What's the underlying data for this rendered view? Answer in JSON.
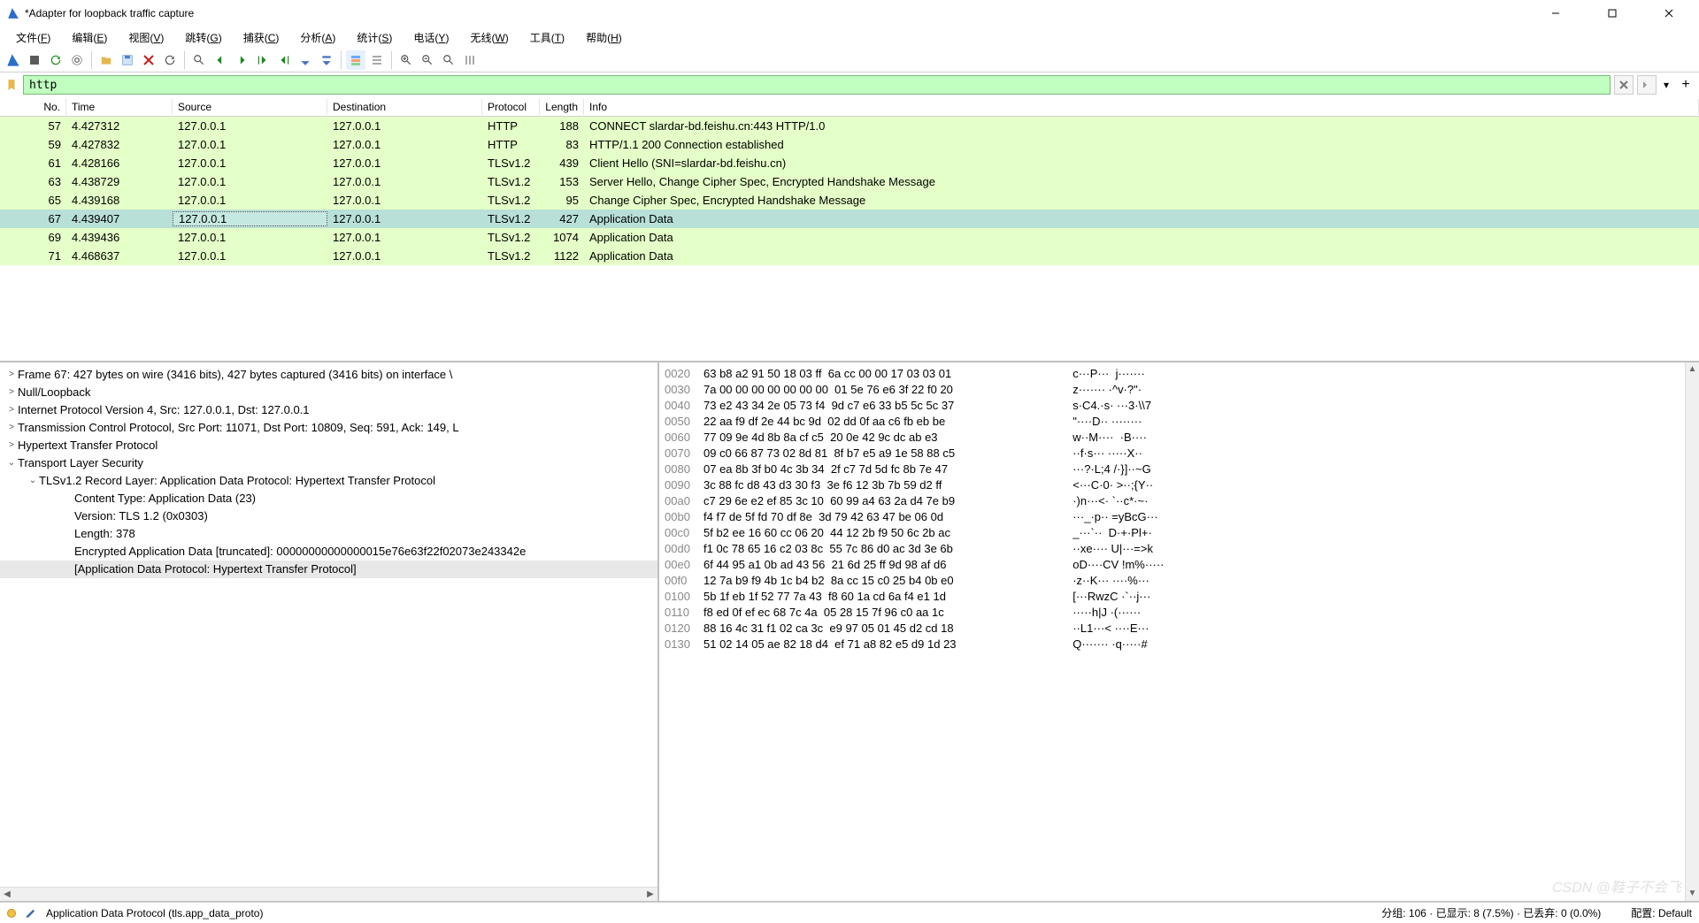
{
  "title": "*Adapter for loopback traffic capture",
  "menus": [
    "文件(F)",
    "编辑(E)",
    "视图(V)",
    "跳转(G)",
    "捕获(C)",
    "分析(A)",
    "统计(S)",
    "电话(Y)",
    "无线(W)",
    "工具(T)",
    "帮助(H)"
  ],
  "filter": {
    "value": "http"
  },
  "columns": [
    "No.",
    "Time",
    "Source",
    "Destination",
    "Protocol",
    "Length",
    "Info"
  ],
  "packets": [
    {
      "no": "57",
      "time": "4.427312",
      "src": "127.0.0.1",
      "dst": "127.0.0.1",
      "proto": "HTTP",
      "len": "188",
      "info": "CONNECT slardar-bd.feishu.cn:443 HTTP/1.0",
      "sel": false
    },
    {
      "no": "59",
      "time": "4.427832",
      "src": "127.0.0.1",
      "dst": "127.0.0.1",
      "proto": "HTTP",
      "len": "83",
      "info": "HTTP/1.1 200 Connection established",
      "sel": false
    },
    {
      "no": "61",
      "time": "4.428166",
      "src": "127.0.0.1",
      "dst": "127.0.0.1",
      "proto": "TLSv1.2",
      "len": "439",
      "info": "Client Hello (SNI=slardar-bd.feishu.cn)",
      "sel": false
    },
    {
      "no": "63",
      "time": "4.438729",
      "src": "127.0.0.1",
      "dst": "127.0.0.1",
      "proto": "TLSv1.2",
      "len": "153",
      "info": "Server Hello, Change Cipher Spec, Encrypted Handshake Message",
      "sel": false
    },
    {
      "no": "65",
      "time": "4.439168",
      "src": "127.0.0.1",
      "dst": "127.0.0.1",
      "proto": "TLSv1.2",
      "len": "95",
      "info": "Change Cipher Spec, Encrypted Handshake Message",
      "sel": false
    },
    {
      "no": "67",
      "time": "4.439407",
      "src": "127.0.0.1",
      "dst": "127.0.0.1",
      "proto": "TLSv1.2",
      "len": "427",
      "info": "Application Data",
      "sel": true
    },
    {
      "no": "69",
      "time": "4.439436",
      "src": "127.0.0.1",
      "dst": "127.0.0.1",
      "proto": "TLSv1.2",
      "len": "1074",
      "info": "Application Data",
      "sel": false
    },
    {
      "no": "71",
      "time": "4.468637",
      "src": "127.0.0.1",
      "dst": "127.0.0.1",
      "proto": "TLSv1.2",
      "len": "1122",
      "info": "Application Data",
      "sel": false
    }
  ],
  "tree": [
    {
      "tw": ">",
      "ind": 0,
      "text": "Frame 67: 427 bytes on wire (3416 bits), 427 bytes captured (3416 bits) on interface \\",
      "sel": false
    },
    {
      "tw": ">",
      "ind": 0,
      "text": "Null/Loopback",
      "sel": false
    },
    {
      "tw": ">",
      "ind": 0,
      "text": "Internet Protocol Version 4, Src: 127.0.0.1, Dst: 127.0.0.1",
      "sel": false
    },
    {
      "tw": ">",
      "ind": 0,
      "text": "Transmission Control Protocol, Src Port: 11071, Dst Port: 10809, Seq: 591, Ack: 149, L",
      "sel": false
    },
    {
      "tw": ">",
      "ind": 0,
      "text": "Hypertext Transfer Protocol",
      "sel": false
    },
    {
      "tw": "v",
      "ind": 0,
      "text": "Transport Layer Security",
      "sel": false
    },
    {
      "tw": "v",
      "ind": 1,
      "text": "TLSv1.2 Record Layer: Application Data Protocol: Hypertext Transfer Protocol",
      "sel": false
    },
    {
      "tw": "",
      "ind": 2,
      "text": "Content Type: Application Data (23)",
      "sel": false
    },
    {
      "tw": "",
      "ind": 2,
      "text": "Version: TLS 1.2 (0x0303)",
      "sel": false
    },
    {
      "tw": "",
      "ind": 2,
      "text": "Length: 378",
      "sel": false
    },
    {
      "tw": "",
      "ind": 2,
      "text": "Encrypted Application Data [truncated]: 00000000000000015e76e63f22f02073e243342e",
      "sel": false
    },
    {
      "tw": "",
      "ind": 2,
      "text": "[Application Data Protocol: Hypertext Transfer Protocol]",
      "sel": true
    }
  ],
  "hex": [
    {
      "off": "0020",
      "b": "63 b8 a2 91 50 18 03 ff  6a cc 00 00 17 03 03 01",
      "a": "c···P···  j·······"
    },
    {
      "off": "0030",
      "b": "7a 00 00 00 00 00 00 00  01 5e 76 e6 3f 22 f0 20",
      "a": "z······· ·^v·?\"· "
    },
    {
      "off": "0040",
      "b": "73 e2 43 34 2e 05 73 f4  9d c7 e6 33 b5 5c 5c 37",
      "a": "s·C4.·s· ···3·\\\\7"
    },
    {
      "off": "0050",
      "b": "22 aa f9 df 2e 44 bc 9d  02 dd 0f aa c6 fb eb be",
      "a": "\"····D·· ········"
    },
    {
      "off": "0060",
      "b": "77 09 9e 4d 8b 8a cf c5  20 0e 42 9c dc ab e3",
      "a": "w··M····  ·B····"
    },
    {
      "off": "0070",
      "b": "09 c0 66 87 73 02 8d 81  8f b7 e5 a9 1e 58 88 c5",
      "a": "··f·s··· ·····X··"
    },
    {
      "off": "0080",
      "b": "07 ea 8b 3f b0 4c 3b 34  2f c7 7d 5d fc 8b 7e 47",
      "a": "···?·L;4 /·}]··~G"
    },
    {
      "off": "0090",
      "b": "3c 88 fc d8 43 d3 30 f3  3e f6 12 3b 7b 59 d2 ff",
      "a": "<···C·0· >··;{Y··"
    },
    {
      "off": "00a0",
      "b": "c7 29 6e e2 ef 85 3c 10  60 99 a4 63 2a d4 7e b9",
      "a": "·)n···<· `··c*·~·"
    },
    {
      "off": "00b0",
      "b": "f4 f7 de 5f fd 70 df 8e  3d 79 42 63 47 be 06 0d",
      "a": "···_·p·· =yBcG···"
    },
    {
      "off": "00c0",
      "b": "5f b2 ee 16 60 cc 06 20  44 12 2b f9 50 6c 2b ac",
      "a": "_···`··  D·+·Pl+·"
    },
    {
      "off": "00d0",
      "b": "f1 0c 78 65 16 c2 03 8c  55 7c 86 d0 ac 3d 3e 6b",
      "a": "··xe···· U|···=>k"
    },
    {
      "off": "00e0",
      "b": "6f 44 95 a1 0b ad 43 56  21 6d 25 ff 9d 98 af d6",
      "a": "oD····CV !m%·····"
    },
    {
      "off": "00f0",
      "b": "12 7a b9 f9 4b 1c b4 b2  8a cc 15 c0 25 b4 0b e0",
      "a": "·z··K··· ····%···"
    },
    {
      "off": "0100",
      "b": "5b 1f eb 1f 52 77 7a 43  f8 60 1a cd 6a f4 e1 1d",
      "a": "[···RwzC ·`··j···"
    },
    {
      "off": "0110",
      "b": "f8 ed 0f ef ec 68 7c 4a  05 28 15 7f 96 c0 aa 1c",
      "a": "·····h|J ·(······"
    },
    {
      "off": "0120",
      "b": "88 16 4c 31 f1 02 ca 3c  e9 97 05 01 45 d2 cd 18",
      "a": "··L1···< ····E···"
    },
    {
      "off": "0130",
      "b": "51 02 14 05 ae 82 18 d4  ef 71 a8 82 e5 d9 1d 23",
      "a": "Q······· ·q·····#"
    }
  ],
  "status": {
    "left": "Application Data Protocol (tls.app_data_proto)",
    "right": "分组: 106 · 已显示: 8 (7.5%) · 已丢弃: 0 (0.0%)",
    "profile": "配置: Default"
  },
  "watermark": "CSDN @鞋子不会飞"
}
